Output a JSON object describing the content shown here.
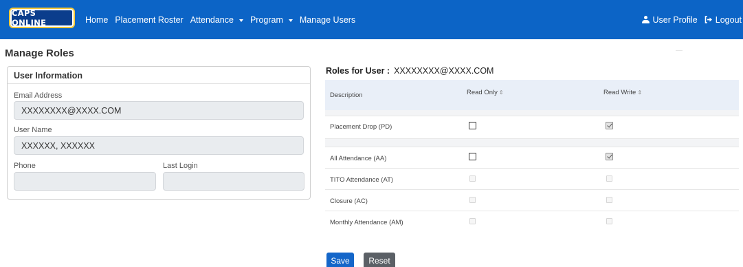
{
  "nav": {
    "logo_text": "CAPS ONLINE",
    "links": [
      {
        "label": "Home",
        "dropdown": false
      },
      {
        "label": "Placement Roster",
        "dropdown": false
      },
      {
        "label": "Attendance",
        "dropdown": true
      },
      {
        "label": "Program",
        "dropdown": true
      },
      {
        "label": "Manage Users",
        "dropdown": false
      }
    ],
    "user_profile": "User Profile",
    "logout": "Logout",
    "background_color": "#0c64c6"
  },
  "page": {
    "title": "Manage Roles"
  },
  "user_info": {
    "title": "User Information",
    "email_label": "Email Address",
    "email_value": "XXXXXXXX@XXXX.COM",
    "username_label": "User Name",
    "username_value": "XXXXXX, XXXXXX",
    "phone_label": "Phone",
    "phone_value": "",
    "last_login_label": "Last Login",
    "last_login_value": ""
  },
  "roles": {
    "header_label": "Roles for User :",
    "header_email": "XXXXXXXX@XXXX.COM",
    "columns": [
      "Description",
      "Read Only",
      "Read Write"
    ],
    "sort_glyph": "⇕",
    "rows": [
      {
        "description": "Placement Drop (PD)",
        "read_only": "unchecked",
        "read_write": "checked"
      },
      {
        "description": "All Attendance (AA)",
        "read_only": "unchecked",
        "read_write": "checked"
      },
      {
        "description": "TITO Attendance (AT)",
        "read_only": "disabled",
        "read_write": "disabled"
      },
      {
        "description": "Closure (AC)",
        "read_only": "disabled",
        "read_write": "disabled"
      },
      {
        "description": "Monthly Attendance (AM)",
        "read_only": "disabled",
        "read_write": "disabled"
      }
    ]
  },
  "actions": {
    "save_label": "Save",
    "reset_label": "Reset",
    "save_color": "#1466c9",
    "reset_color": "#5b6066"
  }
}
